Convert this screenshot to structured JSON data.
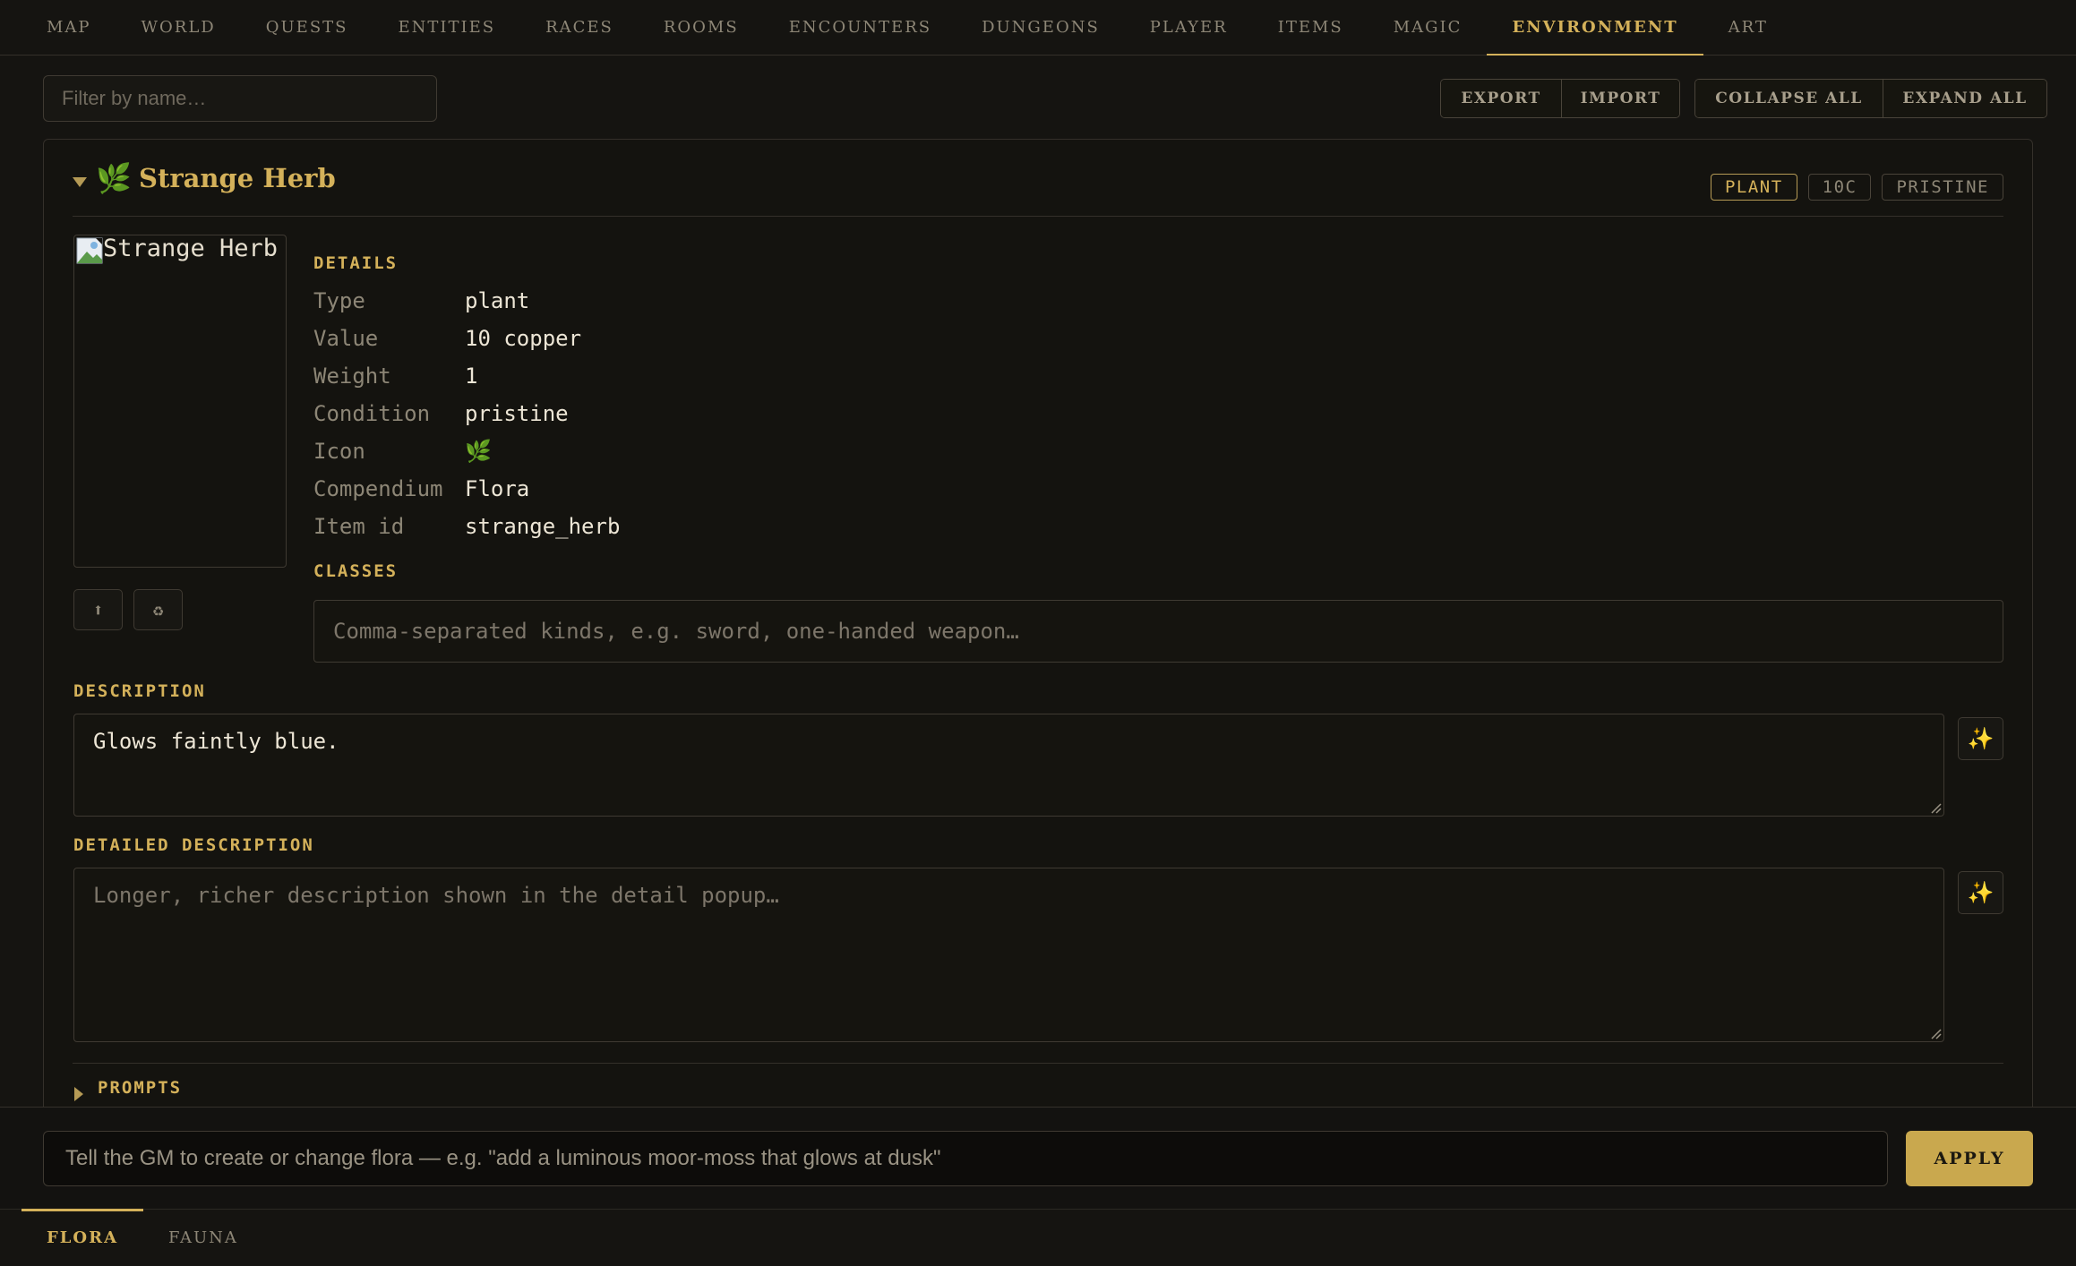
{
  "nav": {
    "tabs": [
      "MAP",
      "WORLD",
      "QUESTS",
      "ENTITIES",
      "RACES",
      "ROOMS",
      "ENCOUNTERS",
      "DUNGEONS",
      "PLAYER",
      "ITEMS",
      "MAGIC",
      "ENVIRONMENT",
      "ART"
    ],
    "active": "ENVIRONMENT"
  },
  "toolbar": {
    "filter_placeholder": "Filter by name…",
    "export_label": "EXPORT",
    "import_label": "IMPORT",
    "collapse_label": "COLLAPSE ALL",
    "expand_label": "EXPAND ALL"
  },
  "item": {
    "icon": "🌿",
    "title": "Strange Herb",
    "badges": [
      "PLANT",
      "10C",
      "PRISTINE"
    ],
    "image_alt": "Strange Herb",
    "upload_icon": "⬆",
    "regen_icon": "♻",
    "details_label": "DETAILS",
    "details": [
      {
        "k": "Type",
        "v": "plant"
      },
      {
        "k": "Value",
        "v": "10 copper"
      },
      {
        "k": "Weight",
        "v": "1"
      },
      {
        "k": "Condition",
        "v": "pristine"
      },
      {
        "k": "Icon",
        "v": "🌿"
      },
      {
        "k": "Compendium",
        "v": "Flora"
      },
      {
        "k": "Item id",
        "v": "strange_herb"
      }
    ],
    "classes_label": "CLASSES",
    "classes_value": "",
    "classes_placeholder": "Comma-separated kinds, e.g. sword, one-handed weapon…",
    "description_label": "DESCRIPTION",
    "description": "Glows faintly blue.",
    "detailed_label": "DETAILED DESCRIPTION",
    "detailed_value": "",
    "detailed_placeholder": "Longer, richer description shown in the detail popup…",
    "sparkle_icon": "✨",
    "prompts_label": "PROMPTS"
  },
  "command": {
    "placeholder": "Tell the GM to create or change flora — e.g. \"add a luminous moor-moss that glows at dusk\"",
    "apply_label": "APPLY"
  },
  "subnav": {
    "tabs": [
      "FLORA",
      "FAUNA"
    ],
    "active": "FLORA"
  },
  "colors": {
    "accent": "#d4b15a",
    "background": "#151411",
    "border": "#3f3a32"
  }
}
